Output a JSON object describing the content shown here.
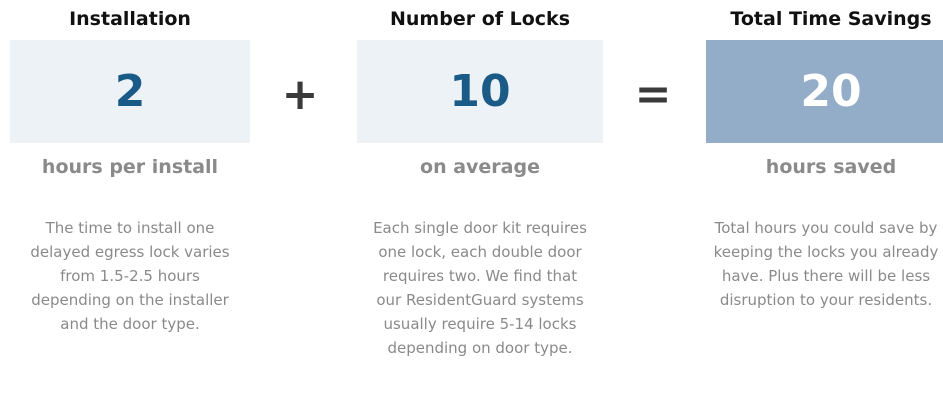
{
  "installation": {
    "heading": "Installation",
    "value": "2",
    "unit": "hours per install",
    "description": "The time to install one delayed egress lock varies from 1.5-2.5 hours depending on the installer and the door type."
  },
  "operators": {
    "plus": "+",
    "equals": "="
  },
  "locks": {
    "heading": "Number of Locks",
    "value": "10",
    "unit": "on average",
    "description": "Each single door kit requires one lock, each double door requires two. We find that our ResidentGuard systems usually require 5-14 locks depending on door type."
  },
  "total": {
    "heading": "Total Time Savings",
    "value": "20",
    "unit": "hours saved",
    "description": "Total hours you could save by keeping the locks you already have. Plus there will be less disruption to your residents."
  },
  "colors": {
    "value_box_bg": "#ecf2f5",
    "total_box_bg": "#93acc8",
    "value_text": "#1a5a86",
    "muted_text": "#8a8a8a"
  }
}
